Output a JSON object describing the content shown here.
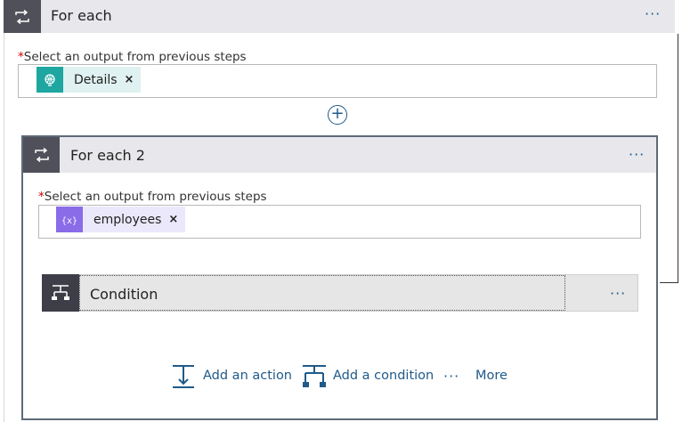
{
  "outer": {
    "title": "For each",
    "menu": "···",
    "field_label": "Select an output from previous steps",
    "required_mark": "*",
    "token": {
      "label": "Details",
      "remove": "×",
      "icon": "globe-icon",
      "color": "#1ea6a0"
    }
  },
  "add_step_symbol": "+",
  "inner": {
    "title": "For each 2",
    "menu": "···",
    "field_label": "Select an output from previous steps",
    "required_mark": "*",
    "token": {
      "label": "employees",
      "remove": "×",
      "icon": "variable-icon",
      "color": "#8a6be8"
    }
  },
  "condition": {
    "title": "Condition",
    "menu": "···"
  },
  "actions": {
    "add_action": "Add an action",
    "add_condition": "Add a condition",
    "more_dots": "···",
    "more": "More"
  },
  "colors": {
    "accent": "#1f5a8a",
    "header_bg": "#e8e8ec",
    "icon_box": "#50505a"
  }
}
